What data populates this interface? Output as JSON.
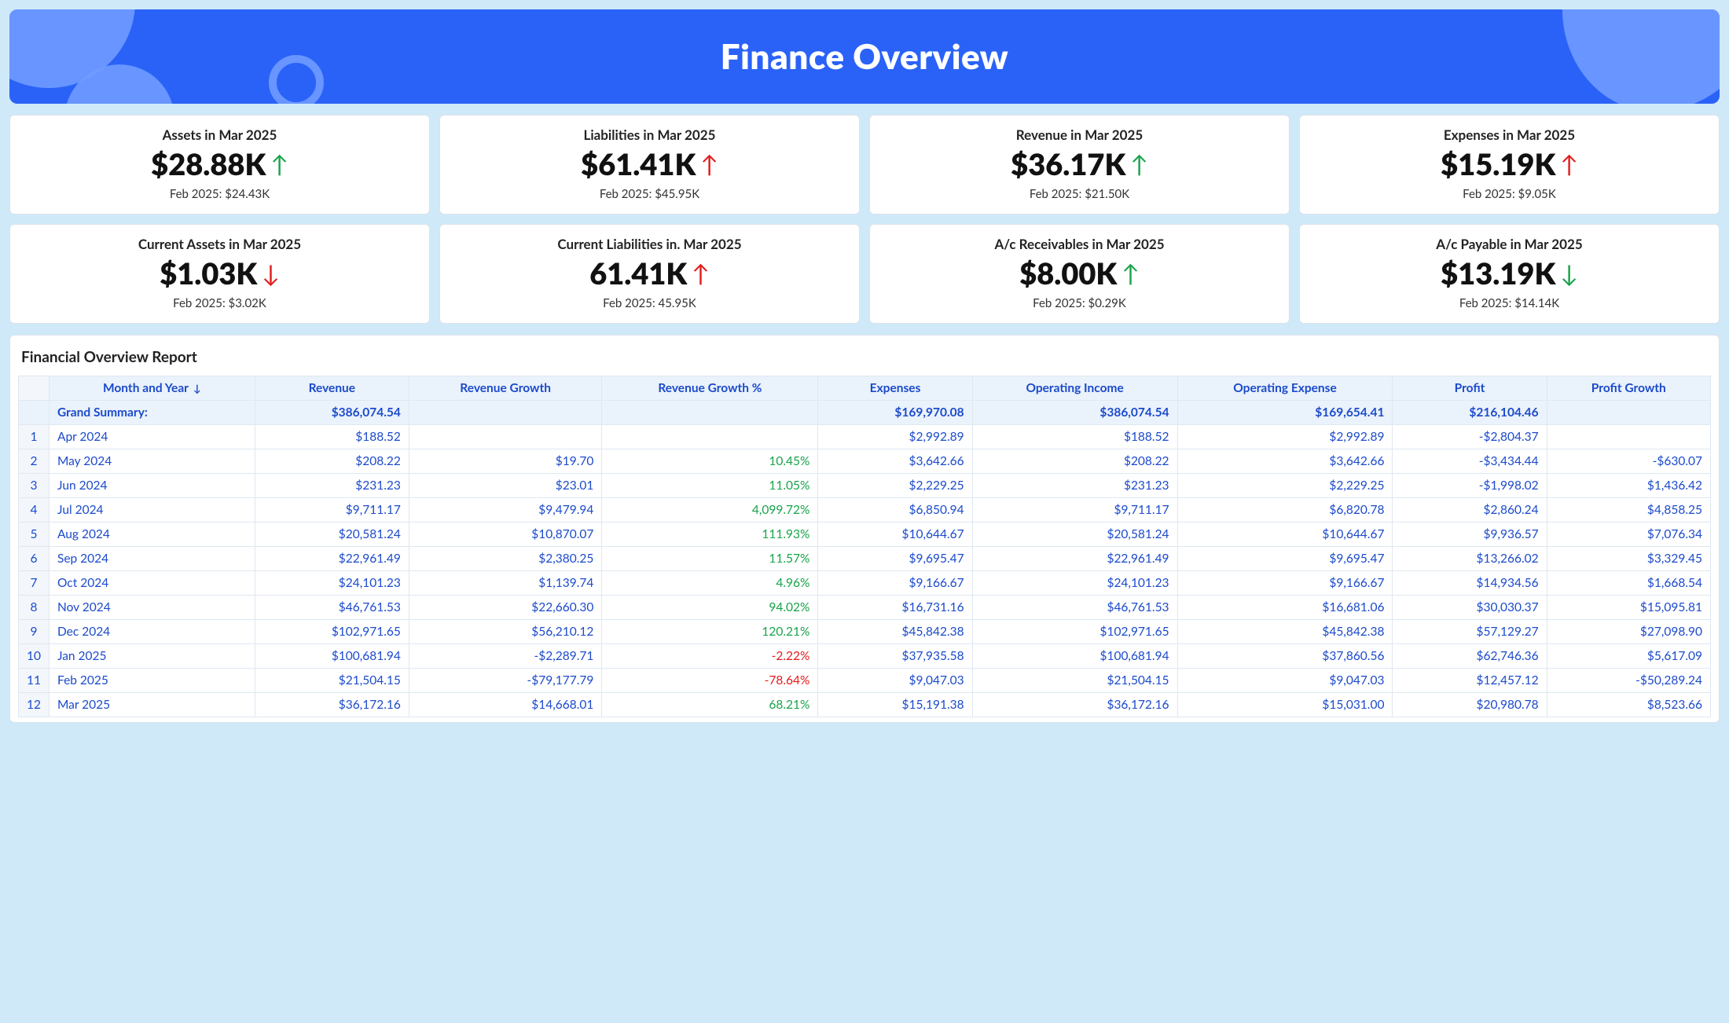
{
  "header": {
    "title": "Finance Overview"
  },
  "cards": [
    {
      "label": "Assets in Mar 2025",
      "value": "$28.88K",
      "dir": "up",
      "tone": "green",
      "prev": "Feb 2025: $24.43K"
    },
    {
      "label": "Liabilities in Mar 2025",
      "value": "$61.41K",
      "dir": "up",
      "tone": "red",
      "prev": "Feb 2025: $45.95K"
    },
    {
      "label": "Revenue in Mar 2025",
      "value": "$36.17K",
      "dir": "up",
      "tone": "green",
      "prev": "Feb 2025: $21.50K"
    },
    {
      "label": "Expenses in Mar 2025",
      "value": "$15.19K",
      "dir": "up",
      "tone": "red",
      "prev": "Feb 2025: $9.05K"
    },
    {
      "label": "Current Assets in Mar 2025",
      "value": "$1.03K",
      "dir": "down",
      "tone": "red",
      "prev": "Feb 2025: $3.02K"
    },
    {
      "label": "Current Liabilities in. Mar 2025",
      "value": "61.41K",
      "dir": "up",
      "tone": "red",
      "prev": "Feb 2025: 45.95K"
    },
    {
      "label": "A/c Receivables in Mar 2025",
      "value": "$8.00K",
      "dir": "up",
      "tone": "green",
      "prev": "Feb 2025: $0.29K"
    },
    {
      "label": "A/c Payable in Mar 2025",
      "value": "$13.19K",
      "dir": "down",
      "tone": "green",
      "prev": "Feb 2025: $14.14K"
    }
  ],
  "report": {
    "title": "Financial Overview Report",
    "columns": [
      "Month and Year",
      "Revenue",
      "Revenue Growth",
      "Revenue Growth %",
      "Expenses",
      "Operating Income",
      "Operating Expense",
      "Profit",
      "Profit Growth"
    ],
    "sort_indicator": "↓",
    "summary_label": "Grand Summary:",
    "summary": {
      "revenue": "$386,074.54",
      "revenue_growth": "",
      "revenue_growth_pct": "",
      "expenses": "$169,970.08",
      "operating_income": "$386,074.54",
      "operating_expense": "$169,654.41",
      "profit": "$216,104.46",
      "profit_growth": ""
    },
    "rows": [
      {
        "n": "1",
        "month": "Apr 2024",
        "revenue": "$188.52",
        "rg": "",
        "rgp": "",
        "rgp_sign": "",
        "expenses": "$2,992.89",
        "oi": "$188.52",
        "oe": "$2,992.89",
        "profit": "-$2,804.37",
        "pg": ""
      },
      {
        "n": "2",
        "month": "May 2024",
        "revenue": "$208.22",
        "rg": "$19.70",
        "rgp": "10.45%",
        "rgp_sign": "pos",
        "expenses": "$3,642.66",
        "oi": "$208.22",
        "oe": "$3,642.66",
        "profit": "-$3,434.44",
        "pg": "-$630.07"
      },
      {
        "n": "3",
        "month": "Jun 2024",
        "revenue": "$231.23",
        "rg": "$23.01",
        "rgp": "11.05%",
        "rgp_sign": "pos",
        "expenses": "$2,229.25",
        "oi": "$231.23",
        "oe": "$2,229.25",
        "profit": "-$1,998.02",
        "pg": "$1,436.42"
      },
      {
        "n": "4",
        "month": "Jul 2024",
        "revenue": "$9,711.17",
        "rg": "$9,479.94",
        "rgp": "4,099.72%",
        "rgp_sign": "pos",
        "expenses": "$6,850.94",
        "oi": "$9,711.17",
        "oe": "$6,820.78",
        "profit": "$2,860.24",
        "pg": "$4,858.25"
      },
      {
        "n": "5",
        "month": "Aug 2024",
        "revenue": "$20,581.24",
        "rg": "$10,870.07",
        "rgp": "111.93%",
        "rgp_sign": "pos",
        "expenses": "$10,644.67",
        "oi": "$20,581.24",
        "oe": "$10,644.67",
        "profit": "$9,936.57",
        "pg": "$7,076.34"
      },
      {
        "n": "6",
        "month": "Sep 2024",
        "revenue": "$22,961.49",
        "rg": "$2,380.25",
        "rgp": "11.57%",
        "rgp_sign": "pos",
        "expenses": "$9,695.47",
        "oi": "$22,961.49",
        "oe": "$9,695.47",
        "profit": "$13,266.02",
        "pg": "$3,329.45"
      },
      {
        "n": "7",
        "month": "Oct 2024",
        "revenue": "$24,101.23",
        "rg": "$1,139.74",
        "rgp": "4.96%",
        "rgp_sign": "pos",
        "expenses": "$9,166.67",
        "oi": "$24,101.23",
        "oe": "$9,166.67",
        "profit": "$14,934.56",
        "pg": "$1,668.54"
      },
      {
        "n": "8",
        "month": "Nov 2024",
        "revenue": "$46,761.53",
        "rg": "$22,660.30",
        "rgp": "94.02%",
        "rgp_sign": "pos",
        "expenses": "$16,731.16",
        "oi": "$46,761.53",
        "oe": "$16,681.06",
        "profit": "$30,030.37",
        "pg": "$15,095.81"
      },
      {
        "n": "9",
        "month": "Dec 2024",
        "revenue": "$102,971.65",
        "rg": "$56,210.12",
        "rgp": "120.21%",
        "rgp_sign": "pos",
        "expenses": "$45,842.38",
        "oi": "$102,971.65",
        "oe": "$45,842.38",
        "profit": "$57,129.27",
        "pg": "$27,098.90"
      },
      {
        "n": "10",
        "month": "Jan 2025",
        "revenue": "$100,681.94",
        "rg": "-$2,289.71",
        "rgp": "-2.22%",
        "rgp_sign": "neg",
        "expenses": "$37,935.58",
        "oi": "$100,681.94",
        "oe": "$37,860.56",
        "profit": "$62,746.36",
        "pg": "$5,617.09"
      },
      {
        "n": "11",
        "month": "Feb 2025",
        "revenue": "$21,504.15",
        "rg": "-$79,177.79",
        "rgp": "-78.64%",
        "rgp_sign": "neg",
        "expenses": "$9,047.03",
        "oi": "$21,504.15",
        "oe": "$9,047.03",
        "profit": "$12,457.12",
        "pg": "-$50,289.24"
      },
      {
        "n": "12",
        "month": "Mar 2025",
        "revenue": "$36,172.16",
        "rg": "$14,668.01",
        "rgp": "68.21%",
        "rgp_sign": "pos",
        "expenses": "$15,191.38",
        "oi": "$36,172.16",
        "oe": "$15,031.00",
        "profit": "$20,980.78",
        "pg": "$8,523.66"
      }
    ]
  }
}
